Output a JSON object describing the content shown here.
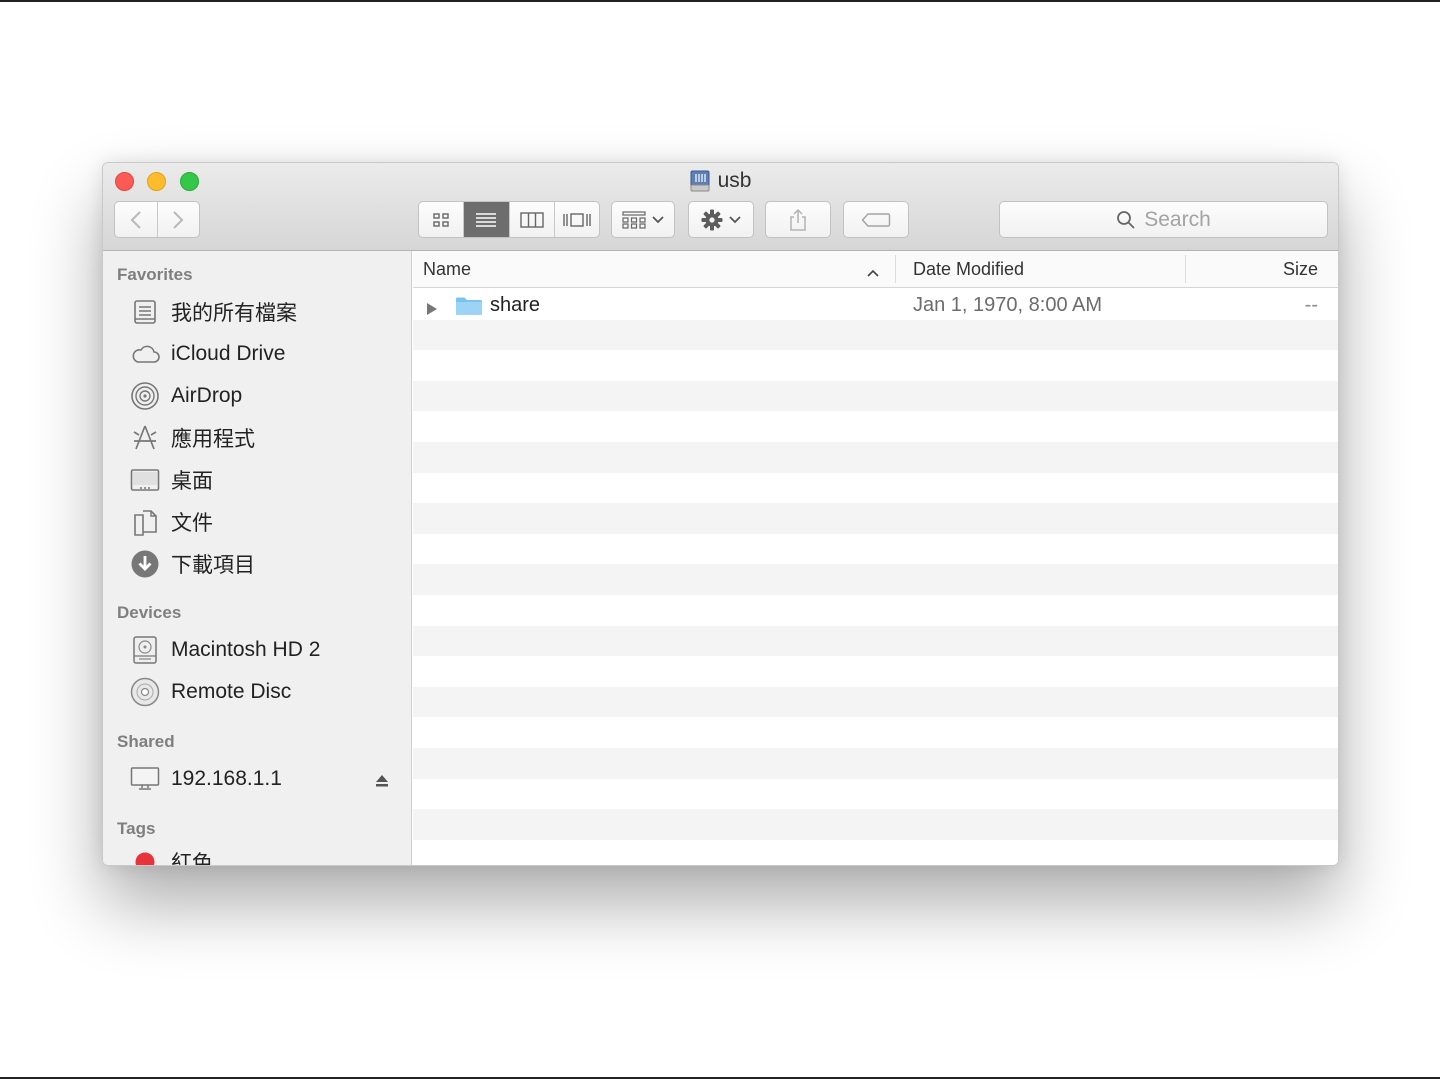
{
  "window": {
    "title": "usb"
  },
  "toolbar": {
    "search_placeholder": "Search"
  },
  "sidebar": {
    "favorites_header": "Favorites",
    "favorites": [
      {
        "label": "我的所有檔案",
        "icon": "all-my-files-icon"
      },
      {
        "label": "iCloud Drive",
        "icon": "cloud-icon"
      },
      {
        "label": "AirDrop",
        "icon": "airdrop-icon"
      },
      {
        "label": "應用程式",
        "icon": "applications-icon"
      },
      {
        "label": "桌面",
        "icon": "desktop-icon"
      },
      {
        "label": "文件",
        "icon": "documents-icon"
      },
      {
        "label": "下載項目",
        "icon": "downloads-icon"
      }
    ],
    "devices_header": "Devices",
    "devices": [
      {
        "label": "Macintosh HD 2",
        "icon": "hard-disk-icon"
      },
      {
        "label": "Remote Disc",
        "icon": "disc-icon"
      }
    ],
    "shared_header": "Shared",
    "shared": [
      {
        "label": "192.168.1.1",
        "icon": "network-computer-icon"
      }
    ],
    "tags_header": "Tags",
    "tags": [
      {
        "label": "紅色",
        "color": "#e8333b"
      }
    ]
  },
  "list": {
    "columns": {
      "name": "Name",
      "date": "Date Modified",
      "size": "Size"
    },
    "rows": [
      {
        "name": "share",
        "date": "Jan 1, 1970, 8:00 AM",
        "size": "--"
      }
    ]
  },
  "colors": {
    "active_view": "#6d6d6d",
    "folder": "#7cc4ef"
  }
}
